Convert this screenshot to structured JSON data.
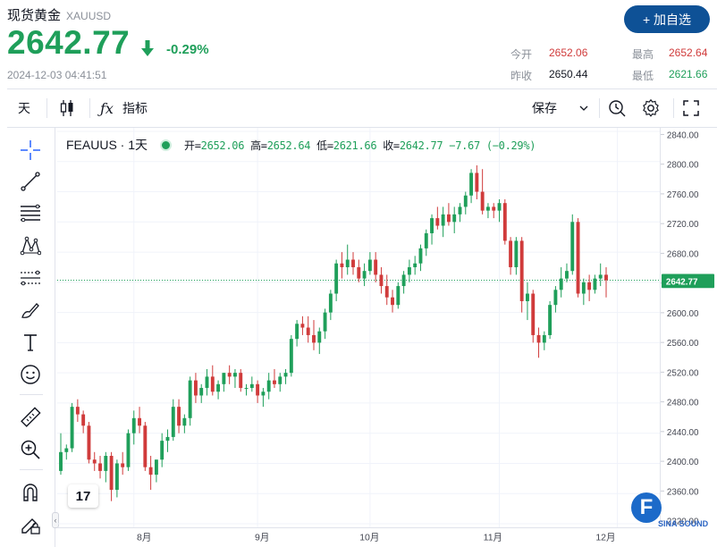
{
  "header": {
    "title": "现货黄金",
    "code": "XAUUSD",
    "price": "2642.77",
    "change": "-0.29%",
    "timestamp": "2024-12-03 04:41:51",
    "add_button": "+ 加自选",
    "stats": {
      "open_label": "今开",
      "open": "2652.06",
      "high_label": "最高",
      "high": "2652.64",
      "prevclose_label": "昨收",
      "prevclose": "2650.44",
      "low_label": "最低",
      "low": "2621.66"
    }
  },
  "toolbar": {
    "interval": "天",
    "indicator_label": "指标",
    "save_label": "保存",
    "icons": [
      "candles-icon",
      "fx-icon",
      "chevron-down-icon",
      "alert-icon",
      "gear-icon",
      "fullscreen-icon"
    ]
  },
  "left_tools": [
    "crosshair-icon",
    "trend-line-icon",
    "fib-lines-icon",
    "pattern-icon",
    "regression-icon",
    "brush-icon",
    "text-icon",
    "emoji-icon",
    "ruler-icon",
    "zoom-in-icon",
    "magnet-icon",
    "lock-pencil-icon"
  ],
  "legend": {
    "symbol": "FEAUUS · 1天",
    "o_label": "开",
    "o": "2652.06",
    "h_label": "高",
    "h": "2652.64",
    "l_label": "低",
    "l": "2621.66",
    "c_label": "收",
    "c": "2642.77",
    "change": "−7.67 (−0.29%)"
  },
  "logos": {
    "tv": "17",
    "sina_letter": "F",
    "sina_text": "SINA SOUND"
  },
  "colors": {
    "up": "#1f9f5a",
    "down": "#d03b3b",
    "accent": "#0e5196"
  },
  "chart_data": {
    "type": "candlestick",
    "ylim": [
      2320,
      2840
    ],
    "yticks": [
      2840,
      2800,
      2760,
      2720,
      2680,
      2640,
      2600,
      2560,
      2520,
      2480,
      2440,
      2400,
      2360,
      2320
    ],
    "xticks": [
      {
        "label": "8月",
        "index": 13
      },
      {
        "label": "9月",
        "index": 35
      },
      {
        "label": "10月",
        "index": 55
      },
      {
        "label": "11月",
        "index": 78
      },
      {
        "label": "12月",
        "index": 99
      }
    ],
    "current_price": 2642.77,
    "current_label": "2642.77",
    "candles": [
      [
        2390,
        2440,
        2385,
        2415
      ],
      [
        2415,
        2425,
        2405,
        2420
      ],
      [
        2420,
        2480,
        2415,
        2475
      ],
      [
        2475,
        2485,
        2455,
        2465
      ],
      [
        2465,
        2470,
        2440,
        2450
      ],
      [
        2450,
        2455,
        2400,
        2405
      ],
      [
        2405,
        2415,
        2390,
        2400
      ],
      [
        2400,
        2410,
        2380,
        2390
      ],
      [
        2390,
        2415,
        2375,
        2410
      ],
      [
        2410,
        2415,
        2350,
        2365
      ],
      [
        2365,
        2405,
        2355,
        2400
      ],
      [
        2400,
        2415,
        2385,
        2395
      ],
      [
        2395,
        2445,
        2390,
        2440
      ],
      [
        2440,
        2470,
        2425,
        2460
      ],
      [
        2460,
        2475,
        2440,
        2450
      ],
      [
        2450,
        2455,
        2390,
        2395
      ],
      [
        2395,
        2410,
        2365,
        2385
      ],
      [
        2385,
        2405,
        2375,
        2405
      ],
      [
        2405,
        2440,
        2395,
        2430
      ],
      [
        2430,
        2445,
        2415,
        2435
      ],
      [
        2435,
        2485,
        2430,
        2475
      ],
      [
        2475,
        2485,
        2440,
        2450
      ],
      [
        2450,
        2465,
        2440,
        2460
      ],
      [
        2460,
        2515,
        2450,
        2510
      ],
      [
        2510,
        2520,
        2480,
        2490
      ],
      [
        2490,
        2505,
        2480,
        2500
      ],
      [
        2500,
        2525,
        2490,
        2515
      ],
      [
        2515,
        2530,
        2490,
        2495
      ],
      [
        2495,
        2510,
        2485,
        2505
      ],
      [
        2505,
        2520,
        2495,
        2520
      ],
      [
        2520,
        2530,
        2505,
        2515
      ],
      [
        2515,
        2525,
        2500,
        2520
      ],
      [
        2520,
        2525,
        2495,
        2500
      ],
      [
        2500,
        2505,
        2490,
        2500
      ],
      [
        2500,
        2515,
        2495,
        2505
      ],
      [
        2505,
        2510,
        2480,
        2490
      ],
      [
        2490,
        2500,
        2475,
        2495
      ],
      [
        2495,
        2520,
        2485,
        2510
      ],
      [
        2510,
        2525,
        2500,
        2505
      ],
      [
        2505,
        2520,
        2495,
        2515
      ],
      [
        2515,
        2525,
        2505,
        2520
      ],
      [
        2520,
        2570,
        2515,
        2565
      ],
      [
        2565,
        2590,
        2555,
        2585
      ],
      [
        2585,
        2595,
        2570,
        2580
      ],
      [
        2580,
        2595,
        2560,
        2570
      ],
      [
        2570,
        2590,
        2550,
        2560
      ],
      [
        2560,
        2580,
        2545,
        2575
      ],
      [
        2575,
        2605,
        2565,
        2600
      ],
      [
        2600,
        2630,
        2590,
        2625
      ],
      [
        2625,
        2670,
        2615,
        2665
      ],
      [
        2665,
        2680,
        2645,
        2660
      ],
      [
        2660,
        2690,
        2650,
        2670
      ],
      [
        2670,
        2680,
        2650,
        2660
      ],
      [
        2660,
        2670,
        2640,
        2645
      ],
      [
        2645,
        2665,
        2635,
        2655
      ],
      [
        2655,
        2680,
        2650,
        2670
      ],
      [
        2670,
        2680,
        2640,
        2650
      ],
      [
        2650,
        2660,
        2625,
        2635
      ],
      [
        2635,
        2650,
        2610,
        2620
      ],
      [
        2620,
        2630,
        2600,
        2610
      ],
      [
        2610,
        2640,
        2605,
        2635
      ],
      [
        2635,
        2655,
        2625,
        2650
      ],
      [
        2650,
        2670,
        2640,
        2660
      ],
      [
        2660,
        2675,
        2650,
        2665
      ],
      [
        2665,
        2690,
        2655,
        2685
      ],
      [
        2685,
        2710,
        2675,
        2705
      ],
      [
        2705,
        2730,
        2690,
        2725
      ],
      [
        2725,
        2740,
        2710,
        2715
      ],
      [
        2715,
        2740,
        2700,
        2730
      ],
      [
        2730,
        2745,
        2715,
        2720
      ],
      [
        2720,
        2740,
        2705,
        2730
      ],
      [
        2730,
        2745,
        2720,
        2740
      ],
      [
        2740,
        2760,
        2730,
        2755
      ],
      [
        2755,
        2790,
        2745,
        2785
      ],
      [
        2785,
        2795,
        2750,
        2760
      ],
      [
        2760,
        2790,
        2730,
        2735
      ],
      [
        2735,
        2745,
        2725,
        2740
      ],
      [
        2740,
        2745,
        2725,
        2735
      ],
      [
        2735,
        2750,
        2720,
        2745
      ],
      [
        2745,
        2750,
        2690,
        2695
      ],
      [
        2695,
        2700,
        2650,
        2660
      ],
      [
        2660,
        2700,
        2650,
        2695
      ],
      [
        2695,
        2700,
        2600,
        2615
      ],
      [
        2615,
        2640,
        2590,
        2625
      ],
      [
        2625,
        2630,
        2560,
        2570
      ],
      [
        2570,
        2580,
        2540,
        2560
      ],
      [
        2560,
        2575,
        2550,
        2570
      ],
      [
        2570,
        2615,
        2565,
        2610
      ],
      [
        2610,
        2635,
        2600,
        2630
      ],
      [
        2630,
        2660,
        2620,
        2645
      ],
      [
        2645,
        2665,
        2640,
        2655
      ],
      [
        2655,
        2730,
        2650,
        2720
      ],
      [
        2720,
        2725,
        2620,
        2625
      ],
      [
        2625,
        2645,
        2610,
        2640
      ],
      [
        2640,
        2650,
        2615,
        2630
      ],
      [
        2630,
        2650,
        2625,
        2645
      ],
      [
        2645,
        2665,
        2635,
        2650
      ],
      [
        2650,
        2660,
        2620,
        2642.77
      ]
    ]
  }
}
